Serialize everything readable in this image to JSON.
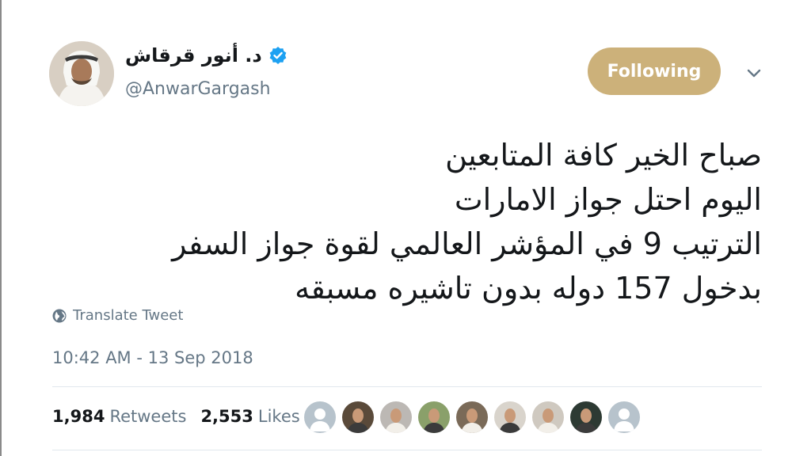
{
  "profile": {
    "display_name": "د. أنور قرقاش",
    "handle": "@AnwarGargash",
    "verified": true,
    "avatar": "profile-avatar"
  },
  "follow_button": {
    "label": "Following",
    "color": "#ccb17a"
  },
  "menu": {
    "icon": "chevron-down-icon"
  },
  "tweet": {
    "lines": [
      "صباح الخير كافة المتابعين",
      "اليوم احتل جواز الامارات",
      "الترتيب 9 في المؤشر العالمي لقوة جواز السفر",
      "بدخول 157 دوله بدون تاشيره مسبقه"
    ]
  },
  "translate": {
    "label": "Translate Tweet",
    "icon": "globe-icon"
  },
  "timestamp": "10:42 AM - 13 Sep 2018",
  "stats": {
    "retweets_count": "1,984",
    "retweets_label": "Retweets",
    "likes_count": "2,553",
    "likes_label": "Likes"
  },
  "likers": [
    {
      "type": "default",
      "bg": "#b7c3cc"
    },
    {
      "type": "photo",
      "bg": "#5a4a3a"
    },
    {
      "type": "photo",
      "bg": "#bcb8b4"
    },
    {
      "type": "photo",
      "bg": "#8aa06a"
    },
    {
      "type": "photo",
      "bg": "#7a6a58"
    },
    {
      "type": "photo",
      "bg": "#d9d4cc"
    },
    {
      "type": "photo",
      "bg": "#cfc9c0"
    },
    {
      "type": "photo",
      "bg": "#2d3a33"
    },
    {
      "type": "default",
      "bg": "#b7c3cc"
    }
  ]
}
